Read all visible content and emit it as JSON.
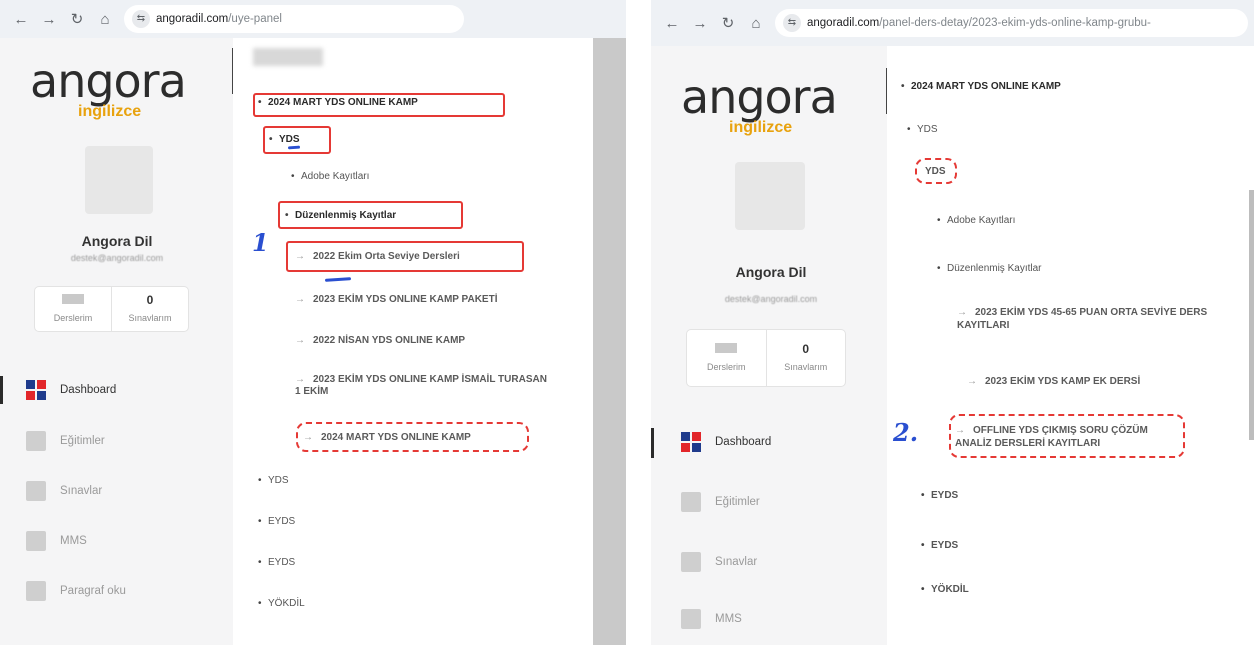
{
  "left": {
    "browser": {
      "url_domain": "angoradil.com",
      "url_path": "/uye-panel"
    },
    "sidebar": {
      "logo_word": "angora",
      "logo_sub": "ingilizce",
      "user_name": "Angora Dil",
      "user_email": "destek@angoradil.com",
      "stats": [
        {
          "value": "",
          "label": "Derslerim"
        },
        {
          "value": "0",
          "label": "Sınavlarım"
        }
      ],
      "menu": [
        {
          "label": "Dashboard",
          "icon": "dashboard-icon",
          "active": true
        },
        {
          "label": "Eğitimler",
          "icon": "courses-icon"
        },
        {
          "label": "Sınavlar",
          "icon": "exams-icon"
        },
        {
          "label": "MMS",
          "icon": "mms-icon"
        },
        {
          "label": "Paragraf oku",
          "icon": "paragraph-icon"
        }
      ]
    },
    "tree": {
      "camp": "2024 MART YDS ONLINE KAMP",
      "yds": "YDS",
      "adobe": "Adobe Kayıtları",
      "edited": "Düzenlenmiş Kayıtlar",
      "leaves": [
        "2022 Ekim Orta Seviye Dersleri",
        "2023 EKİM YDS ONLINE KAMP PAKETİ",
        "2022 NİSAN YDS ONLINE KAMP",
        "2023 EKİM YDS ONLINE KAMP İSMAİL TURASAN 1 EKİM",
        "2024 MART YDS ONLINE KAMP"
      ],
      "others": [
        "YDS",
        "EYDS",
        "EYDS",
        "YÖKDİL"
      ]
    },
    "annotation_number": "1"
  },
  "right": {
    "browser": {
      "url_domain": "angoradil.com",
      "url_path": "/panel-ders-detay/2023-ekim-yds-online-kamp-grubu-"
    },
    "sidebar": {
      "logo_word": "angora",
      "logo_sub": "ingilizce",
      "user_name": "Angora Dil",
      "user_email": "destek@angoradil.com",
      "stats": [
        {
          "value": "",
          "label": "Derslerim"
        },
        {
          "value": "0",
          "label": "Sınavlarım"
        }
      ],
      "menu": [
        {
          "label": "Dashboard",
          "icon": "dashboard-icon",
          "active": true
        },
        {
          "label": "Eğitimler",
          "icon": "courses-icon"
        },
        {
          "label": "Sınavlar",
          "icon": "exams-icon"
        },
        {
          "label": "MMS",
          "icon": "mms-icon"
        }
      ]
    },
    "tree": {
      "camp": "2024 MART YDS ONLINE KAMP",
      "yds": "YDS",
      "yds_highlight": "YDS",
      "adobe": "Adobe Kayıtları",
      "edited": "Düzenlenmiş Kayıtlar",
      "leaves": [
        "2023 EKİM YDS 45-65 PUAN ORTA SEVİYE DERS KAYITLARI",
        "2023 EKİM YDS KAMP EK DERSİ",
        "OFFLINE YDS ÇIKMIŞ SORU ÇÖZÜM ANALİZ DERSLERİ KAYITLARI"
      ],
      "others": [
        "EYDS",
        "EYDS",
        "YÖKDİL"
      ]
    },
    "annotation_number": "2."
  },
  "colors": {
    "annotation_red": "#e53935",
    "annotation_blue": "#2a4fd0",
    "logo_orange": "#e8a20e",
    "sidebar_bg": "#f5f5f6"
  }
}
